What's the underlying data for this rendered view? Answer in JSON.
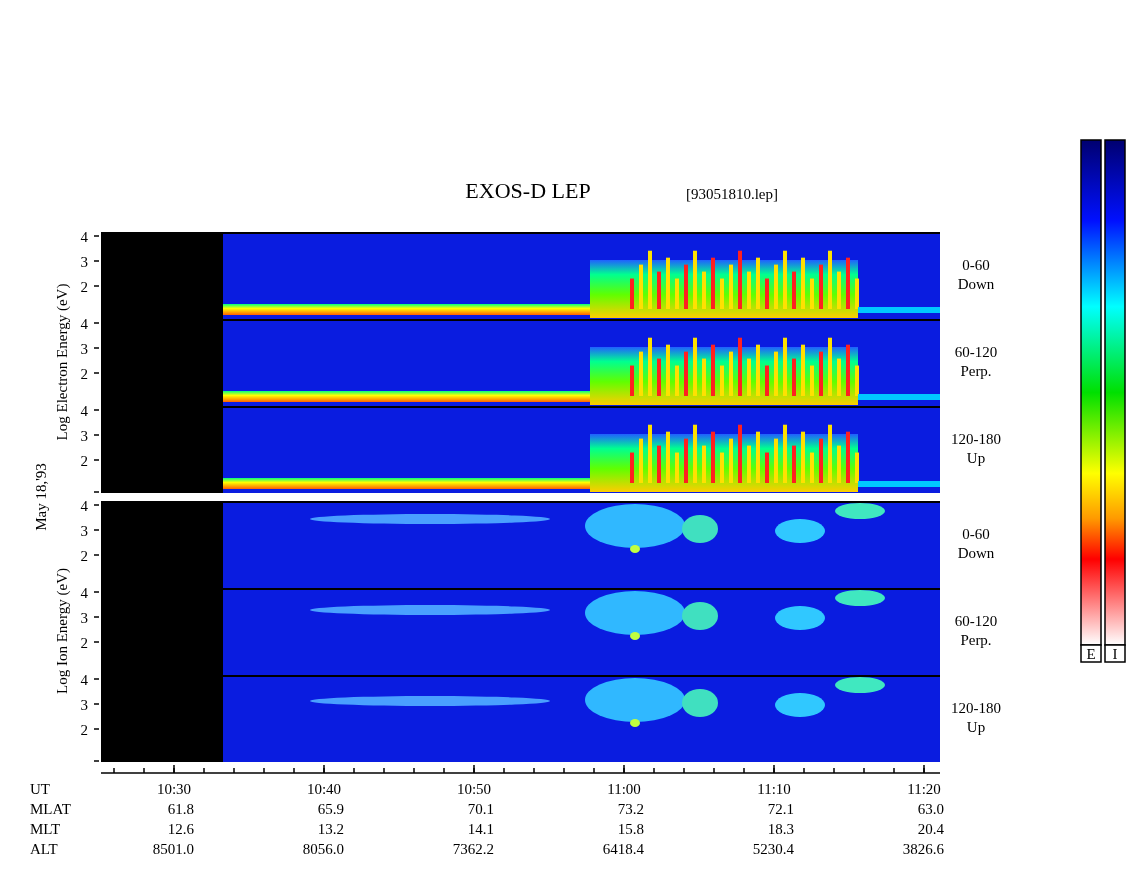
{
  "title": "EXOS-D LEP",
  "file_label": "[93051810.lep]",
  "date": "May 18,'93",
  "groups": [
    {
      "kind": "electron",
      "axis_label": "Log Electron Energy (eV)",
      "panels": [
        {
          "range": "0-60",
          "direction": "Down",
          "ticks": [
            "4",
            "3",
            "2"
          ]
        },
        {
          "range": "60-120",
          "direction": "Perp.",
          "ticks": [
            "4",
            "3",
            "2"
          ]
        },
        {
          "range": "120-180",
          "direction": "Up",
          "ticks": [
            "4",
            "3",
            "2"
          ]
        }
      ]
    },
    {
      "kind": "ion",
      "axis_label": "Log Ion Energy (eV)",
      "panels": [
        {
          "range": "0-60",
          "direction": "Down",
          "ticks": [
            "4",
            "3",
            "2"
          ]
        },
        {
          "range": "60-120",
          "direction": "Perp.",
          "ticks": [
            "4",
            "3",
            "2"
          ]
        },
        {
          "range": "120-180",
          "direction": "Up",
          "ticks": [
            "4",
            "3",
            "2"
          ]
        }
      ]
    }
  ],
  "time_axis": {
    "rows": [
      {
        "label": "UT",
        "values": [
          "10:30",
          "10:40",
          "10:50",
          "11:00",
          "11:10",
          "11:20"
        ]
      },
      {
        "label": "MLAT",
        "values": [
          "61.8",
          "65.9",
          "70.1",
          "73.2",
          "72.1",
          "63.0"
        ]
      },
      {
        "label": "MLT",
        "values": [
          "12.6",
          "13.2",
          "14.1",
          "15.8",
          "18.3",
          "20.4"
        ]
      },
      {
        "label": "ALT",
        "values": [
          "8501.0",
          "8056.0",
          "7362.2",
          "6418.4",
          "5230.4",
          "3826.6"
        ]
      }
    ]
  },
  "colorbars": [
    {
      "label": "E"
    },
    {
      "label": "I"
    }
  ]
}
